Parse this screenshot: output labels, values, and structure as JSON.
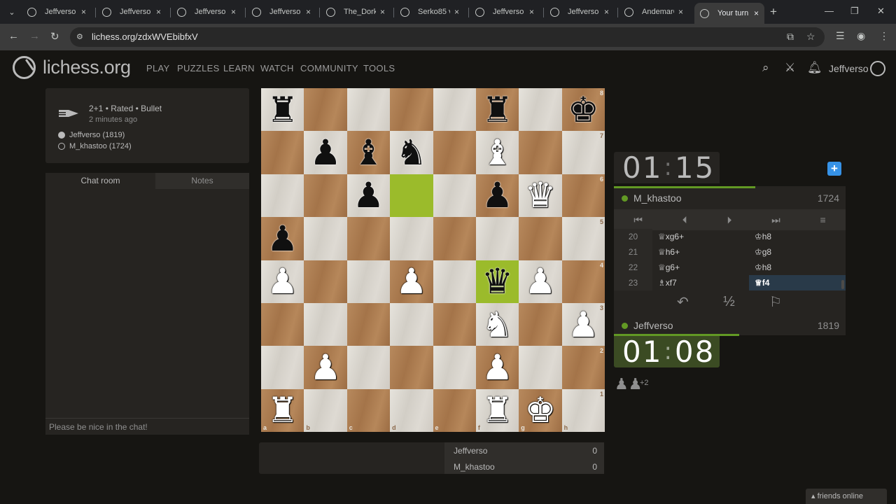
{
  "browser": {
    "tabs": [
      {
        "title": "Jeffverso v"
      },
      {
        "title": "Jeffverso v"
      },
      {
        "title": "Jeffverso v"
      },
      {
        "title": "Jeffverso v"
      },
      {
        "title": "The_Dork_"
      },
      {
        "title": "Serko85 vs"
      },
      {
        "title": "Jeffverso v"
      },
      {
        "title": "Jeffverso v"
      },
      {
        "title": "AndemarC"
      },
      {
        "title": "Your turn"
      }
    ],
    "url": "lichess.org/zdxWVEbibfxV",
    "icons": {
      "tab_close": "×",
      "new_tab": "+",
      "back": "←",
      "forward": "→",
      "reload": "↻",
      "minimize": "—",
      "maximize": "❐",
      "close": "✕",
      "star": "☆"
    }
  },
  "site": {
    "logo_text": "lichess.org",
    "nav": [
      "PLAY",
      "PUZZLES",
      "LEARN",
      "WATCH",
      "COMMUNITY",
      "TOOLS"
    ],
    "username": "Jeffverso"
  },
  "game_info": {
    "title": "2+1 • Rated • Bullet",
    "time": "2 minutes ago",
    "white_player": "Jeffverso (1819)",
    "black_player": "M_khastoo (1724)"
  },
  "chat": {
    "tab_chat": "Chat room",
    "tab_notes": "Notes",
    "placeholder": "Please be nice in the chat!"
  },
  "board": {
    "rows": [
      [
        "r",
        "",
        "",
        "",
        "",
        "r",
        "",
        "k"
      ],
      [
        "",
        "p",
        "b",
        "n",
        "",
        "B",
        "",
        ""
      ],
      [
        "",
        "",
        "p",
        "",
        "",
        "p",
        "Q",
        ""
      ],
      [
        "p",
        "",
        "",
        "",
        "",
        "",
        "",
        ""
      ],
      [
        "P",
        "",
        "",
        "P",
        "",
        "q",
        "P",
        ""
      ],
      [
        "",
        "",
        "",
        "",
        "",
        "N",
        "",
        "P"
      ],
      [
        "",
        "P",
        "",
        "",
        "",
        "P",
        "",
        ""
      ],
      [
        "R",
        "",
        "",
        "",
        "",
        "R",
        "K",
        ""
      ]
    ],
    "highlight": [
      [
        2,
        3
      ],
      [
        4,
        5
      ]
    ],
    "ranks": [
      "8",
      "7",
      "6",
      "5",
      "4",
      "3",
      "2",
      "1"
    ],
    "files": [
      "a",
      "b",
      "c",
      "d",
      "e",
      "f",
      "g",
      "h"
    ]
  },
  "score": {
    "player1": "Jeffverso",
    "score1": "0",
    "player2": "M_khastoo",
    "score2": "0"
  },
  "clock_top": {
    "min": "01",
    "sec": "15"
  },
  "clock_bottom": {
    "min": "01",
    "sec": "08"
  },
  "opponent": {
    "name": "M_khastoo",
    "rating": "1724"
  },
  "me": {
    "name": "Jeffverso",
    "rating": "1819"
  },
  "clock_top_fraction": 0.58,
  "clock_bottom_fraction": 0.54,
  "moves": [
    {
      "num": "20",
      "white": "♕xg6+",
      "black": "♔h8"
    },
    {
      "num": "21",
      "white": "♕h6+",
      "black": "♔g8"
    },
    {
      "num": "22",
      "white": "♕g6+",
      "black": "♔h8"
    },
    {
      "num": "23",
      "white": "♗xf7",
      "black": "♕f4"
    }
  ],
  "controls": {
    "first": "⏮",
    "prev": "⏴",
    "next": "⏵",
    "last": "⏭",
    "menu": "≡"
  },
  "actions": {
    "takeback": "↶",
    "draw": "½",
    "resign": "⚐"
  },
  "material": {
    "pieces": "♟♟",
    "diff": "+2"
  },
  "friends": "friends online",
  "colors": {
    "accent": "#629924",
    "highlight": "#9bbb2b",
    "selected": "#293a49",
    "plus": "#3692e7"
  }
}
